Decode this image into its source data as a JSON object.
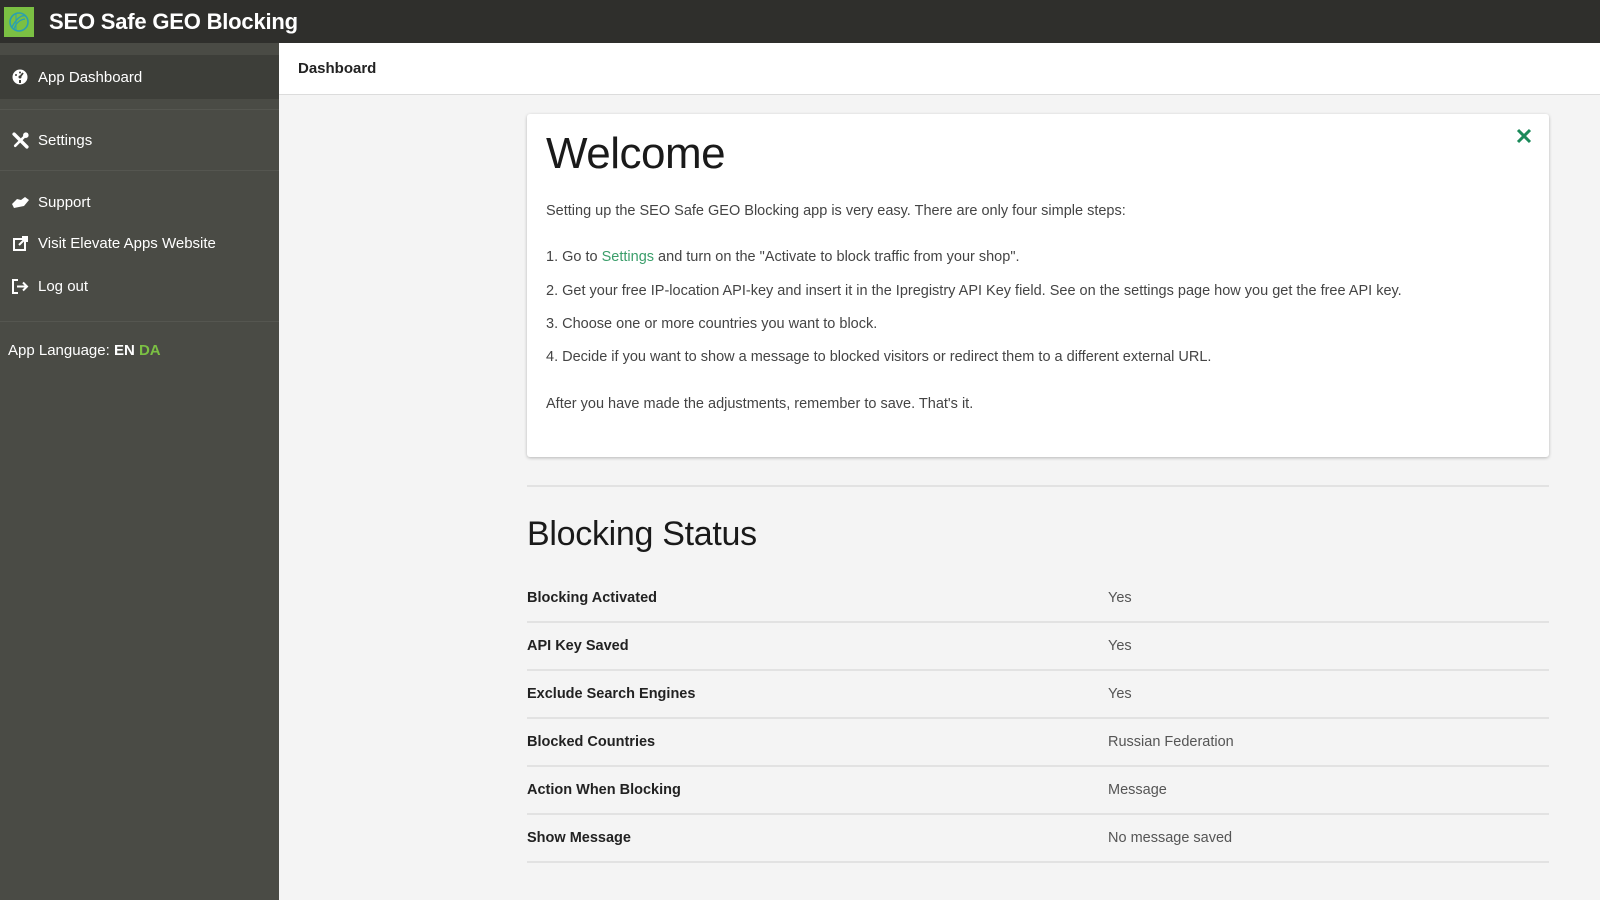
{
  "app": {
    "title": "SEO Safe GEO Blocking",
    "logo_icon": "globe-leaf-logo",
    "brand_color": "#7bc043",
    "link_color": "#3a9e6a"
  },
  "sidebar": {
    "items": [
      {
        "label": "App Dashboard",
        "icon": "dashboard-gauge-icon",
        "active": true
      },
      {
        "label": "Settings",
        "icon": "tools-icon"
      },
      {
        "label": "Support",
        "icon": "handshake-icon"
      },
      {
        "label": "Visit Elevate Apps Website",
        "icon": "external-link-icon"
      },
      {
        "label": "Log out",
        "icon": "sign-out-icon"
      }
    ],
    "language": {
      "label": "App Language:",
      "current": "EN",
      "other": "DA"
    }
  },
  "breadcrumb": {
    "current": "Dashboard"
  },
  "welcome": {
    "title": "Welcome",
    "intro": "Setting up the SEO Safe GEO Blocking app is very easy. There are only four simple steps:",
    "steps": [
      {
        "prefix": "1. Go to ",
        "link": "Settings",
        "suffix": " and turn on the \"Activate to block traffic from your shop\"."
      },
      {
        "text": "2. Get your free IP-location API-key and insert it in the Ipregistry API Key field. See on the settings page how you get the free API key."
      },
      {
        "text": "3. Choose one or more countries you want to block."
      },
      {
        "text": "4. Decide if you want to show a message to blocked visitors or redirect them to a different external URL."
      }
    ],
    "outro": "After you have made the adjustments, remember to save. That's it.",
    "close_icon": "close-x-icon"
  },
  "blocking_status": {
    "title": "Blocking Status",
    "rows": [
      {
        "label": "Blocking Activated",
        "value": "Yes"
      },
      {
        "label": "API Key Saved",
        "value": "Yes"
      },
      {
        "label": "Exclude Search Engines",
        "value": "Yes"
      },
      {
        "label": "Blocked Countries",
        "value": "Russian Federation"
      },
      {
        "label": "Action When Blocking",
        "value": "Message"
      },
      {
        "label": "Show Message",
        "value": "No message saved"
      }
    ]
  }
}
